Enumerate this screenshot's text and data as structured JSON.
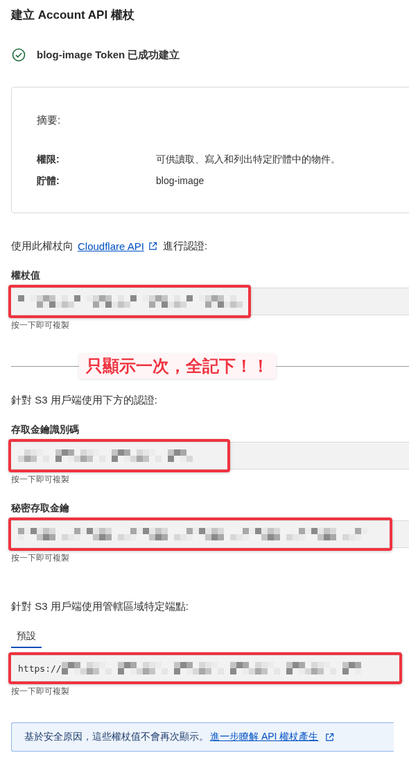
{
  "title": "建立 Account API 權杖",
  "success": {
    "message": "blog-image Token 已成功建立"
  },
  "summary": {
    "heading": "摘要:",
    "rows": [
      {
        "label": "權限:",
        "value": "可供讀取、寫入和列出特定貯體中的物件。"
      },
      {
        "label": "貯體:",
        "value": "blog-image"
      }
    ]
  },
  "auth_intro": {
    "before": "使用此權杖向",
    "link": "Cloudflare API",
    "after": "進行認證:"
  },
  "token_field": {
    "label": "權杖值",
    "hint": "按一下即可複製"
  },
  "annotation": "只顯示一次，全記下！！",
  "s3_intro": "針對 S3 用戶端使用下方的認證:",
  "s3_fields": [
    {
      "label": "存取金鑰識別碼",
      "hint": "按一下即可複製"
    },
    {
      "label": "秘密存取金鑰",
      "hint": "按一下即可複製"
    }
  ],
  "endpoint_intro": "針對 S3 用戶端使用管轄區域特定端點:",
  "tabs": [
    {
      "label": "預設",
      "selected": true
    }
  ],
  "endpoint_field": {
    "value": "https://",
    "hint": "按一下即可複製"
  },
  "notice": {
    "text": "基於安全原因，這些權杖值不會再次顯示。",
    "link": "進一步瞭解 API 權杖產生"
  }
}
